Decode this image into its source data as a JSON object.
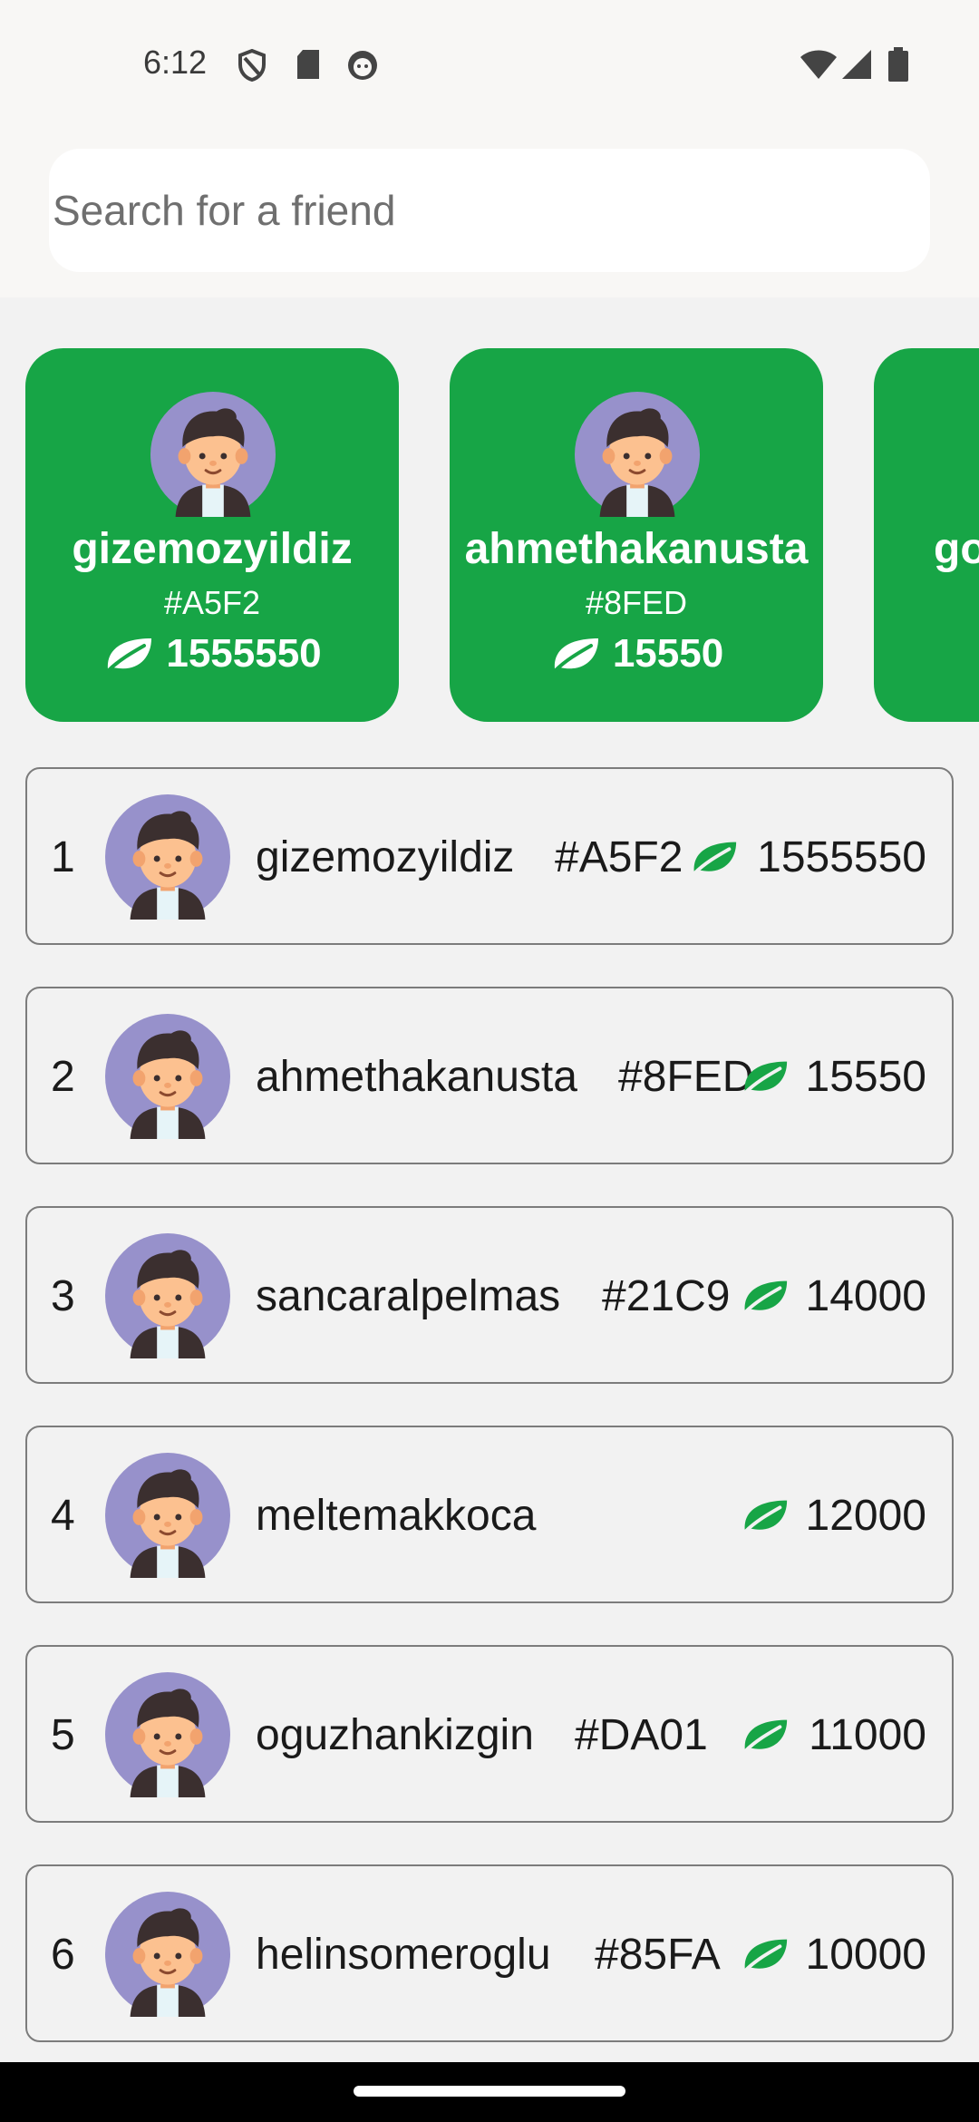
{
  "status_bar": {
    "time": "6:12",
    "left_icons": [
      "shield-icon",
      "sd-card-icon",
      "face-icon"
    ],
    "right_icons": [
      "wifi-icon",
      "signal-icon",
      "battery-icon"
    ]
  },
  "search": {
    "placeholder": "Search for a friend",
    "value": ""
  },
  "colors": {
    "accent": "#17a546",
    "leaf": "#17a546",
    "avatar_bg": "#9791cb"
  },
  "top_cards": [
    {
      "name": "gizemozyildiz",
      "tag": "#A5F2",
      "score": "1555550",
      "icon": "leaf-icon"
    },
    {
      "name": "ahmethakanusta",
      "tag": "#8FED",
      "score": "15550",
      "icon": "leaf-icon"
    },
    {
      "name": "go",
      "tag": "",
      "score": "",
      "icon": ""
    }
  ],
  "leaderboard": [
    {
      "rank": "1",
      "name": "gizemozyildiz",
      "tag": "#A5F2",
      "score": "1555550"
    },
    {
      "rank": "2",
      "name": "ahmethakanusta",
      "tag": "#8FED",
      "score": "15550"
    },
    {
      "rank": "3",
      "name": "sancaralpelmas",
      "tag": "#21C9",
      "score": "14000"
    },
    {
      "rank": "4",
      "name": "meltemakkoca",
      "tag": "",
      "score": "12000"
    },
    {
      "rank": "5",
      "name": "oguzhankizgin",
      "tag": "#DA01",
      "score": "11000"
    },
    {
      "rank": "6",
      "name": "helinsomeroglu",
      "tag": "#85FA",
      "score": "10000"
    }
  ]
}
